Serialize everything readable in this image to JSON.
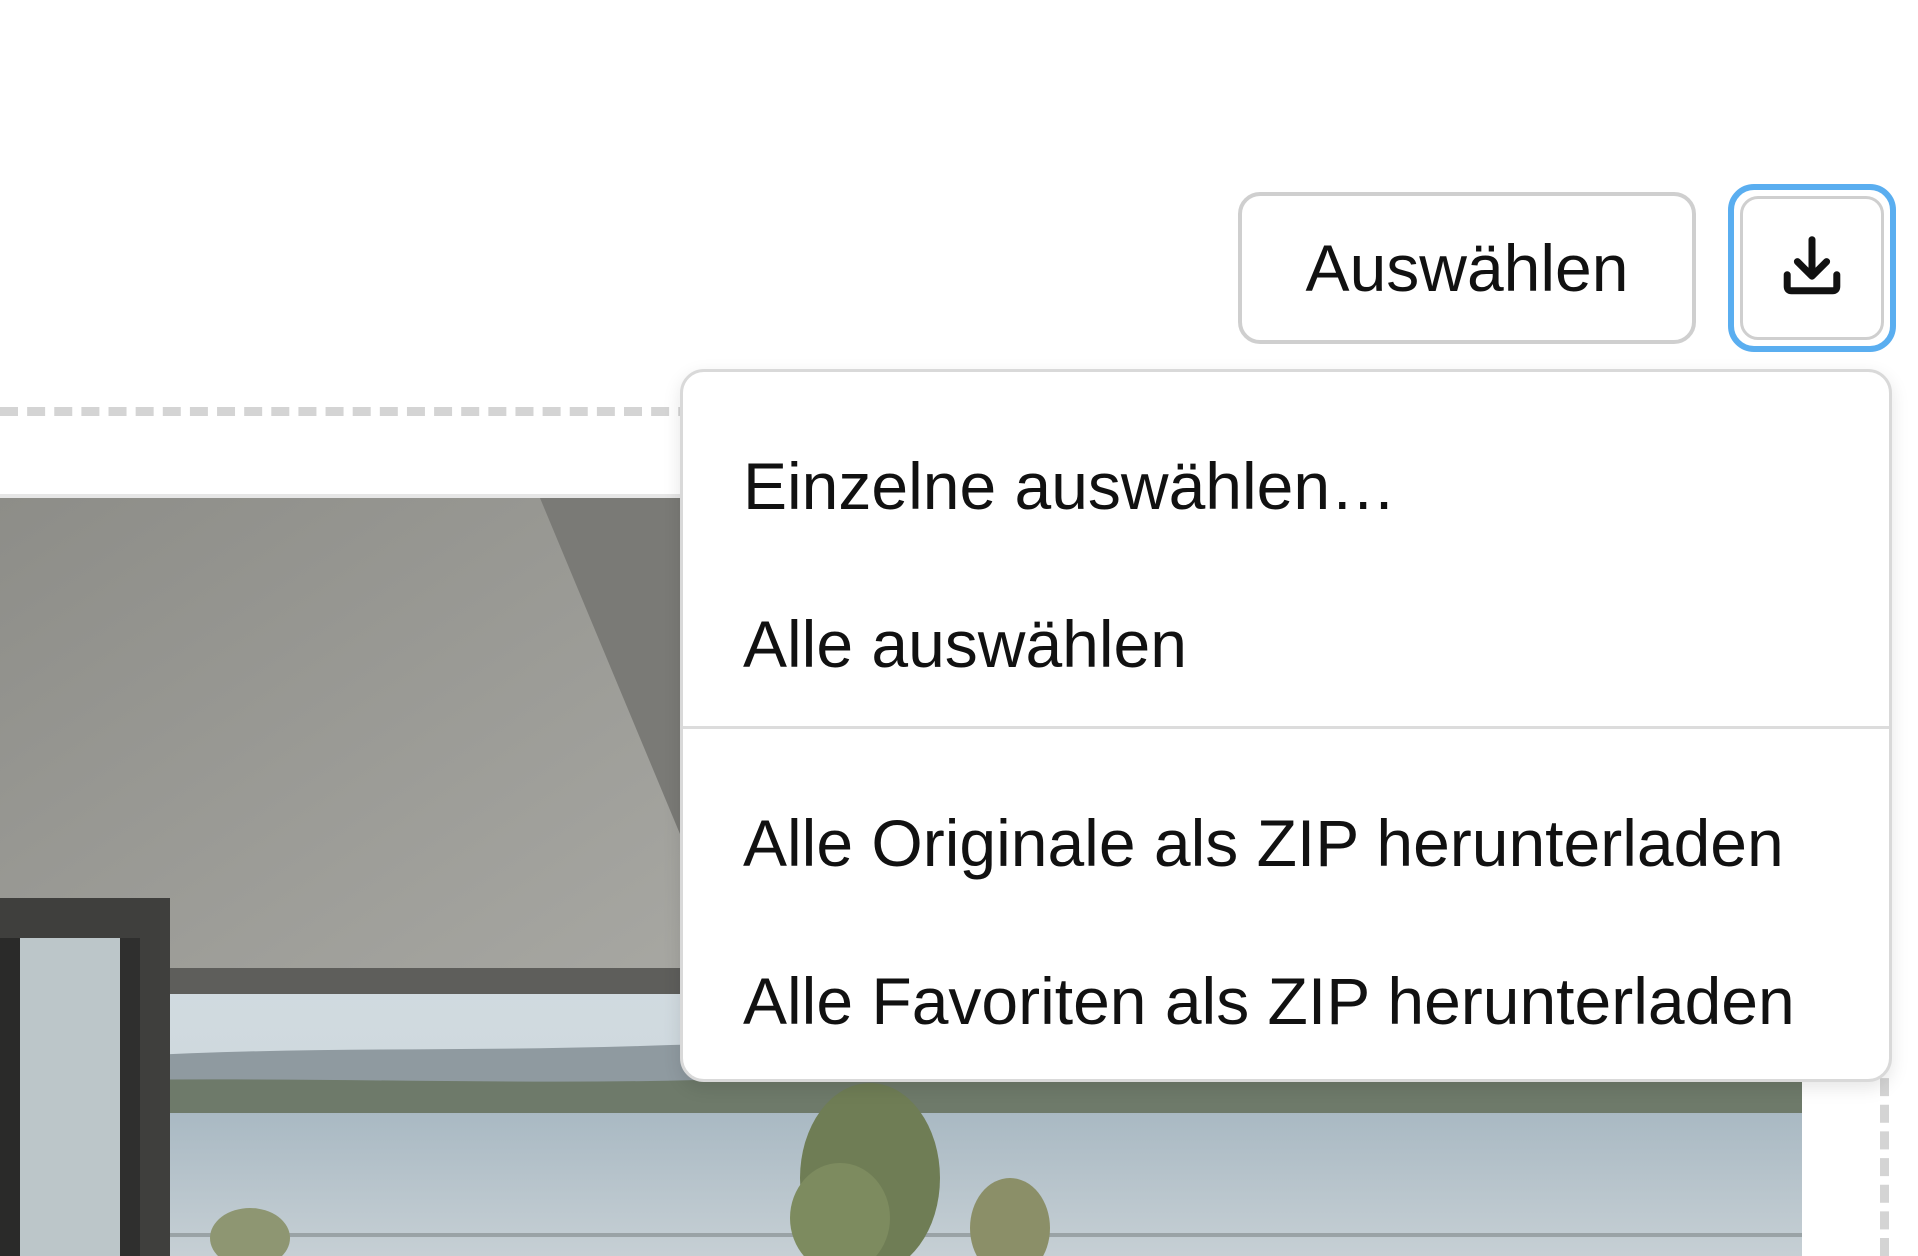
{
  "toolbar": {
    "select_label": "Auswählen",
    "download_icon": "download-icon",
    "download_focused": true
  },
  "menu": {
    "items": [
      {
        "label": "Einzelne auswählen…"
      },
      {
        "label": "Alle auswählen"
      },
      {
        "label": "Alle Originale als ZIP herunterladen"
      },
      {
        "label": "Alle Favoriten als ZIP herunterladen"
      }
    ]
  },
  "colors": {
    "focus_ring": "#5aaef0",
    "button_border": "#cfcfcf",
    "text": "#111111"
  }
}
